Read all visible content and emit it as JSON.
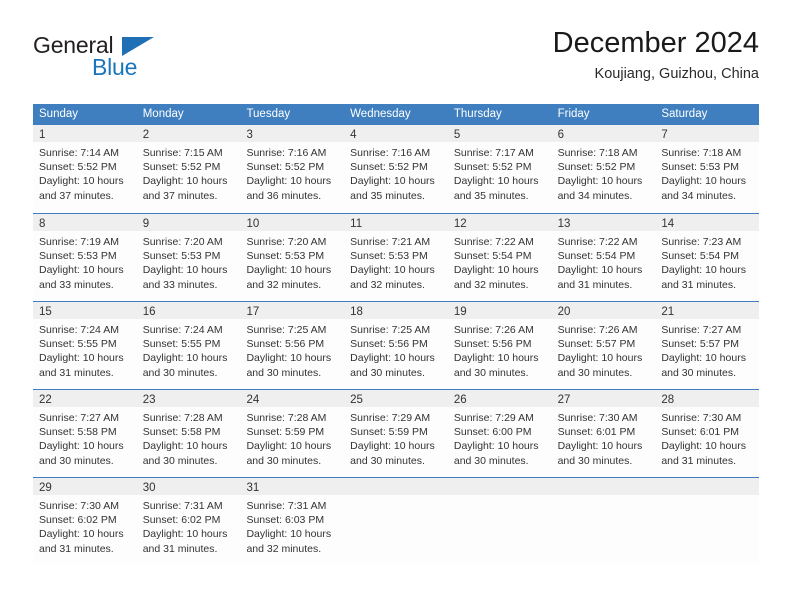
{
  "brand": {
    "name_top": "General",
    "name_bottom": "Blue",
    "triangle_color": "#1f6fb5",
    "blue_text_color": "#1b75bb"
  },
  "header": {
    "title": "December 2024",
    "location": "Koujiang, Guizhou, China"
  },
  "theme": {
    "header_blue": "#3f7fbf",
    "daynum_band": "#efefef",
    "cell_bg": "#fdfdfd",
    "text": "#333333"
  },
  "calendar": {
    "weekday_headers": [
      "Sunday",
      "Monday",
      "Tuesday",
      "Wednesday",
      "Thursday",
      "Friday",
      "Saturday"
    ],
    "weeks": [
      [
        {
          "day": "1",
          "sunrise": "Sunrise: 7:14 AM",
          "sunset": "Sunset: 5:52 PM",
          "daylight_1": "Daylight: 10 hours",
          "daylight_2": "and 37 minutes."
        },
        {
          "day": "2",
          "sunrise": "Sunrise: 7:15 AM",
          "sunset": "Sunset: 5:52 PM",
          "daylight_1": "Daylight: 10 hours",
          "daylight_2": "and 37 minutes."
        },
        {
          "day": "3",
          "sunrise": "Sunrise: 7:16 AM",
          "sunset": "Sunset: 5:52 PM",
          "daylight_1": "Daylight: 10 hours",
          "daylight_2": "and 36 minutes."
        },
        {
          "day": "4",
          "sunrise": "Sunrise: 7:16 AM",
          "sunset": "Sunset: 5:52 PM",
          "daylight_1": "Daylight: 10 hours",
          "daylight_2": "and 35 minutes."
        },
        {
          "day": "5",
          "sunrise": "Sunrise: 7:17 AM",
          "sunset": "Sunset: 5:52 PM",
          "daylight_1": "Daylight: 10 hours",
          "daylight_2": "and 35 minutes."
        },
        {
          "day": "6",
          "sunrise": "Sunrise: 7:18 AM",
          "sunset": "Sunset: 5:52 PM",
          "daylight_1": "Daylight: 10 hours",
          "daylight_2": "and 34 minutes."
        },
        {
          "day": "7",
          "sunrise": "Sunrise: 7:18 AM",
          "sunset": "Sunset: 5:53 PM",
          "daylight_1": "Daylight: 10 hours",
          "daylight_2": "and 34 minutes."
        }
      ],
      [
        {
          "day": "8",
          "sunrise": "Sunrise: 7:19 AM",
          "sunset": "Sunset: 5:53 PM",
          "daylight_1": "Daylight: 10 hours",
          "daylight_2": "and 33 minutes."
        },
        {
          "day": "9",
          "sunrise": "Sunrise: 7:20 AM",
          "sunset": "Sunset: 5:53 PM",
          "daylight_1": "Daylight: 10 hours",
          "daylight_2": "and 33 minutes."
        },
        {
          "day": "10",
          "sunrise": "Sunrise: 7:20 AM",
          "sunset": "Sunset: 5:53 PM",
          "daylight_1": "Daylight: 10 hours",
          "daylight_2": "and 32 minutes."
        },
        {
          "day": "11",
          "sunrise": "Sunrise: 7:21 AM",
          "sunset": "Sunset: 5:53 PM",
          "daylight_1": "Daylight: 10 hours",
          "daylight_2": "and 32 minutes."
        },
        {
          "day": "12",
          "sunrise": "Sunrise: 7:22 AM",
          "sunset": "Sunset: 5:54 PM",
          "daylight_1": "Daylight: 10 hours",
          "daylight_2": "and 32 minutes."
        },
        {
          "day": "13",
          "sunrise": "Sunrise: 7:22 AM",
          "sunset": "Sunset: 5:54 PM",
          "daylight_1": "Daylight: 10 hours",
          "daylight_2": "and 31 minutes."
        },
        {
          "day": "14",
          "sunrise": "Sunrise: 7:23 AM",
          "sunset": "Sunset: 5:54 PM",
          "daylight_1": "Daylight: 10 hours",
          "daylight_2": "and 31 minutes."
        }
      ],
      [
        {
          "day": "15",
          "sunrise": "Sunrise: 7:24 AM",
          "sunset": "Sunset: 5:55 PM",
          "daylight_1": "Daylight: 10 hours",
          "daylight_2": "and 31 minutes."
        },
        {
          "day": "16",
          "sunrise": "Sunrise: 7:24 AM",
          "sunset": "Sunset: 5:55 PM",
          "daylight_1": "Daylight: 10 hours",
          "daylight_2": "and 30 minutes."
        },
        {
          "day": "17",
          "sunrise": "Sunrise: 7:25 AM",
          "sunset": "Sunset: 5:56 PM",
          "daylight_1": "Daylight: 10 hours",
          "daylight_2": "and 30 minutes."
        },
        {
          "day": "18",
          "sunrise": "Sunrise: 7:25 AM",
          "sunset": "Sunset: 5:56 PM",
          "daylight_1": "Daylight: 10 hours",
          "daylight_2": "and 30 minutes."
        },
        {
          "day": "19",
          "sunrise": "Sunrise: 7:26 AM",
          "sunset": "Sunset: 5:56 PM",
          "daylight_1": "Daylight: 10 hours",
          "daylight_2": "and 30 minutes."
        },
        {
          "day": "20",
          "sunrise": "Sunrise: 7:26 AM",
          "sunset": "Sunset: 5:57 PM",
          "daylight_1": "Daylight: 10 hours",
          "daylight_2": "and 30 minutes."
        },
        {
          "day": "21",
          "sunrise": "Sunrise: 7:27 AM",
          "sunset": "Sunset: 5:57 PM",
          "daylight_1": "Daylight: 10 hours",
          "daylight_2": "and 30 minutes."
        }
      ],
      [
        {
          "day": "22",
          "sunrise": "Sunrise: 7:27 AM",
          "sunset": "Sunset: 5:58 PM",
          "daylight_1": "Daylight: 10 hours",
          "daylight_2": "and 30 minutes."
        },
        {
          "day": "23",
          "sunrise": "Sunrise: 7:28 AM",
          "sunset": "Sunset: 5:58 PM",
          "daylight_1": "Daylight: 10 hours",
          "daylight_2": "and 30 minutes."
        },
        {
          "day": "24",
          "sunrise": "Sunrise: 7:28 AM",
          "sunset": "Sunset: 5:59 PM",
          "daylight_1": "Daylight: 10 hours",
          "daylight_2": "and 30 minutes."
        },
        {
          "day": "25",
          "sunrise": "Sunrise: 7:29 AM",
          "sunset": "Sunset: 5:59 PM",
          "daylight_1": "Daylight: 10 hours",
          "daylight_2": "and 30 minutes."
        },
        {
          "day": "26",
          "sunrise": "Sunrise: 7:29 AM",
          "sunset": "Sunset: 6:00 PM",
          "daylight_1": "Daylight: 10 hours",
          "daylight_2": "and 30 minutes."
        },
        {
          "day": "27",
          "sunrise": "Sunrise: 7:30 AM",
          "sunset": "Sunset: 6:01 PM",
          "daylight_1": "Daylight: 10 hours",
          "daylight_2": "and 30 minutes."
        },
        {
          "day": "28",
          "sunrise": "Sunrise: 7:30 AM",
          "sunset": "Sunset: 6:01 PM",
          "daylight_1": "Daylight: 10 hours",
          "daylight_2": "and 31 minutes."
        }
      ],
      [
        {
          "day": "29",
          "sunrise": "Sunrise: 7:30 AM",
          "sunset": "Sunset: 6:02 PM",
          "daylight_1": "Daylight: 10 hours",
          "daylight_2": "and 31 minutes."
        },
        {
          "day": "30",
          "sunrise": "Sunrise: 7:31 AM",
          "sunset": "Sunset: 6:02 PM",
          "daylight_1": "Daylight: 10 hours",
          "daylight_2": "and 31 minutes."
        },
        {
          "day": "31",
          "sunrise": "Sunrise: 7:31 AM",
          "sunset": "Sunset: 6:03 PM",
          "daylight_1": "Daylight: 10 hours",
          "daylight_2": "and 32 minutes."
        },
        {
          "day": "",
          "sunrise": "",
          "sunset": "",
          "daylight_1": "",
          "daylight_2": ""
        },
        {
          "day": "",
          "sunrise": "",
          "sunset": "",
          "daylight_1": "",
          "daylight_2": ""
        },
        {
          "day": "",
          "sunrise": "",
          "sunset": "",
          "daylight_1": "",
          "daylight_2": ""
        },
        {
          "day": "",
          "sunrise": "",
          "sunset": "",
          "daylight_1": "",
          "daylight_2": ""
        }
      ]
    ]
  }
}
